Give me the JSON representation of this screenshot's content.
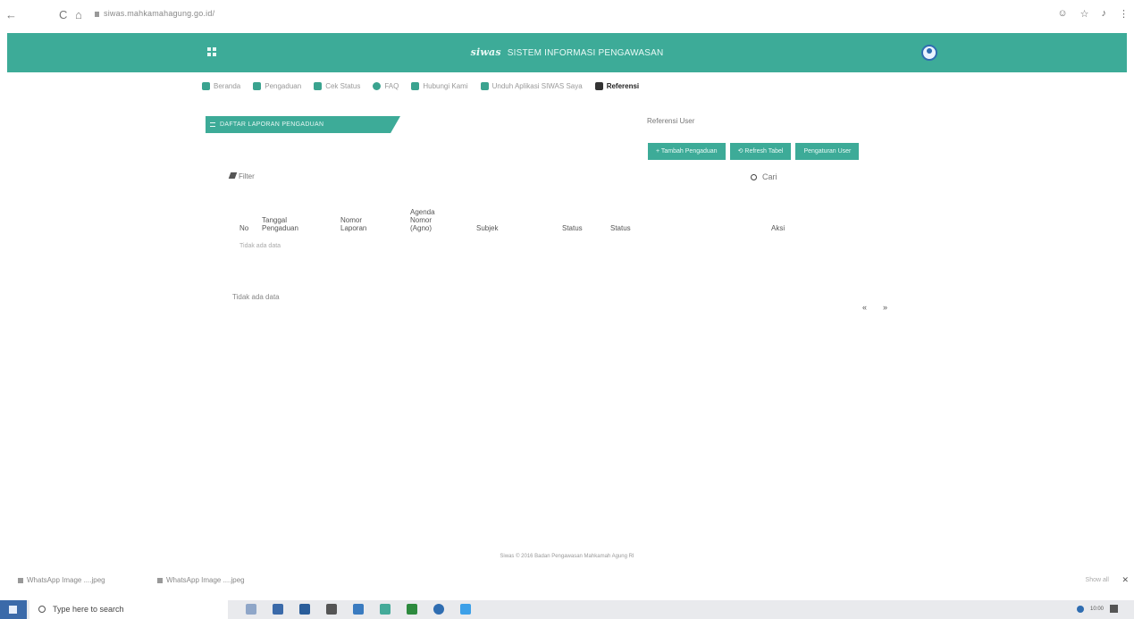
{
  "browser": {
    "url": "siwas.mahkamahagung.go.id/",
    "back_icon": "←",
    "reload_icon": "C",
    "home_icon": "⌂",
    "profile_icon": "☺",
    "star_icon": "☆",
    "extension_icon": "♪",
    "menu_icon": "⋮"
  },
  "header": {
    "logo_text": "siwas",
    "title": "SISTEM INFORMASI PENGAWASAN"
  },
  "nav": [
    {
      "label": "Beranda"
    },
    {
      "label": "Pengaduan"
    },
    {
      "label": "Cek Status"
    },
    {
      "label": "FAQ"
    },
    {
      "label": "Hubungi Kami"
    },
    {
      "label": "Unduh Aplikasi SIWAS Saya"
    },
    {
      "label": "Referensi"
    }
  ],
  "section": {
    "tab_label": "DAFTAR LAPORAN PENGADUAN",
    "ref_user_label": "Referensi User",
    "buttons": {
      "add": "+ Tambah Pengaduan",
      "refresh": "⟲ Refresh Tabel",
      "profile": "Pengaturan User"
    },
    "filter_label": "Filter",
    "search_label": "Cari"
  },
  "table": {
    "headers": {
      "no": "No",
      "tanggal": "Tanggal\nPengaduan",
      "nomor": "Nomor\nLaporan",
      "agenda": "Agenda\nNomor\n(Agno)",
      "subjek": "Subjek",
      "sumber": "Status",
      "status": "Status",
      "aksi": "Aksi"
    },
    "empty_text": "Tidak ada data"
  },
  "showing_text": "Tidak ada data",
  "pager": {
    "prev": "«",
    "next": "»"
  },
  "footer_text": "Siwas © 2016 Badan Pengawasan Mahkamah Agung RI",
  "downloads": [
    {
      "label": "WhatsApp Image ....jpeg"
    },
    {
      "label": "WhatsApp Image ....jpeg"
    }
  ],
  "downloads_showall": "Show all",
  "downloads_close": "✕",
  "taskbar": {
    "search_placeholder": "Type here to search",
    "time": "10:00"
  },
  "colors": {
    "primary": "#3dab98",
    "taskbar_start": "#3b6aa9"
  }
}
